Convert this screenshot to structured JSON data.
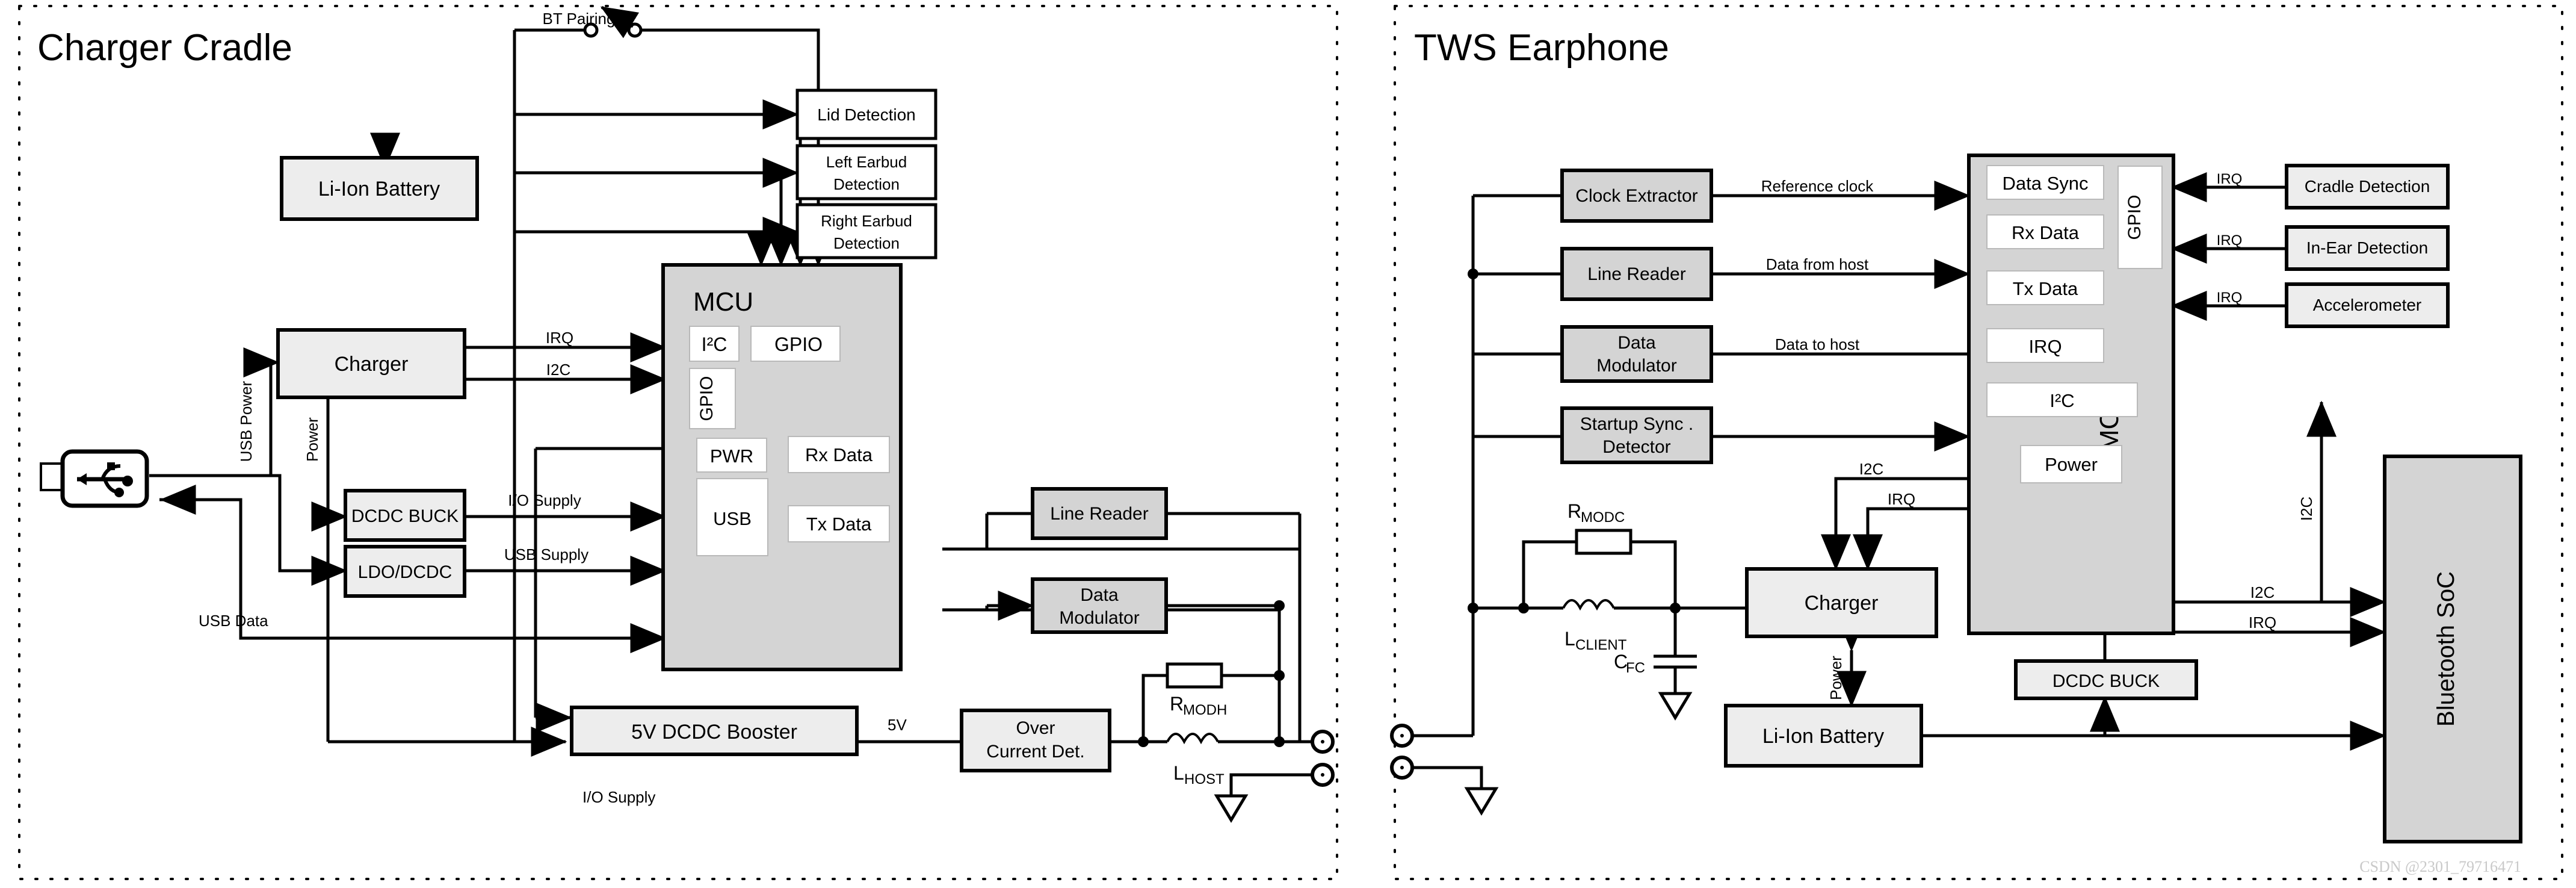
{
  "panels": {
    "left": {
      "title": "Charger Cradle",
      "blocks": {
        "li_ion_battery": "Li-Ion Battery",
        "charger": "Charger",
        "dcdc_buck": "DCDC BUCK",
        "ldo_dcdc": "LDO/DCDC",
        "mcu": "MCU",
        "lid_detection": "Lid Detection",
        "left_earbud_detection_l1": "Left Earbud",
        "left_earbud_detection_l2": "Detection",
        "right_earbud_detection_l1": "Right Earbud",
        "right_earbud_detection_l2": "Detection",
        "line_reader": "Line Reader",
        "data_modulator_l1": "Data",
        "data_modulator_l2": "Modulator",
        "booster": "5V DCDC Booster",
        "over_current_l1": "Over",
        "over_current_l2": "Current Det."
      },
      "mcu_subblocks": {
        "i2c": "I²C",
        "gpio_top": "GPIO",
        "gpio_side": "GPIO",
        "pwr": "PWR",
        "usb": "USB",
        "rx_data": "Rx Data",
        "tx_data": "Tx Data"
      },
      "wire_labels": {
        "bt_pairing": "BT Pairing",
        "power_battery": "Power",
        "usb_power": "USB Power",
        "power_charger": "Power",
        "irq": "IRQ",
        "i2c": "I2C",
        "io_supply": "I/O Supply",
        "usb_supply": "USB Supply",
        "usb_data": "USB Data",
        "io_supply_bottom": "I/O Supply",
        "five_volt": "5V"
      },
      "components": {
        "r_modh_base": "R",
        "r_modh_sub": "MODH",
        "l_host_base": "L",
        "l_host_sub": "HOST"
      },
      "icons": {
        "usb_connector": "usb-connector-icon",
        "ground": "ground-icon",
        "switch": "toggle-switch-icon"
      }
    },
    "right": {
      "title": "TWS Earphone",
      "blocks": {
        "clock_extractor": "Clock Extractor",
        "line_reader": "Line Reader",
        "data_modulator_l1": "Data",
        "data_modulator_l2": "Modulator",
        "startup_sync_l1": "Startup Sync .",
        "startup_sync_l2": "Detector",
        "charger": "Charger",
        "li_ion_battery": "Li-Ion Battery",
        "dcdc_buck": "DCDC BUCK",
        "mcu": "MCU",
        "bluetooth_soc": "Bluetooth SoC",
        "cradle_detection": "Cradle Detection",
        "in_ear_detection": "In-Ear Detection",
        "accelerometer": "Accelerometer"
      },
      "mcu_subblocks": {
        "data_sync": "Data Sync",
        "rx_data": "Rx Data",
        "tx_data": "Tx Data",
        "irq": "IRQ",
        "i2c": "I²C",
        "power": "Power",
        "gpio": "GPIO"
      },
      "wire_labels": {
        "reference_clock": "Reference clock",
        "data_from_host": "Data from host",
        "data_to_host": "Data to host",
        "i2c_charger": "I2C",
        "irq_charger": "IRQ",
        "power_charger": "Power",
        "irq_cradle": "IRQ",
        "irq_inear": "IRQ",
        "irq_accel": "IRQ",
        "i2c_accel": "I2C",
        "i2c_soc": "I2C",
        "irq_soc": "IRQ"
      },
      "components": {
        "r_modc_base": "R",
        "r_modc_sub": "MODC",
        "l_client_base": "L",
        "l_client_sub": "CLIENT",
        "c_fc_base": "C",
        "c_fc_sub": "FC"
      }
    }
  },
  "watermark": "CSDN @2301_79716471"
}
